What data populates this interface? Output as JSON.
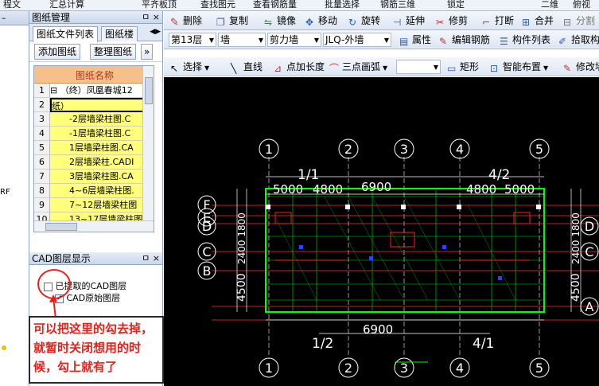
{
  "top_strip": {
    "items": [
      "程文",
      "汇总计算",
      "平齐板顶",
      "查找图元",
      "查看钢筋量",
      "批量选择",
      "钢筋三维",
      "锁定",
      "二维",
      "俯视"
    ]
  },
  "left_narrow": {
    "label": "RF"
  },
  "drawing_manager": {
    "title": "图纸管理",
    "header_btns": "ㅁ ×",
    "tabs": [
      "图纸文件列表",
      "图纸楼"
    ],
    "buttons": [
      "添加图纸",
      "整理图纸"
    ],
    "column_header": "图纸名称",
    "rows": [
      {
        "num": "1",
        "text": "（终）凤凰春城12",
        "style": "tree"
      },
      {
        "num": "2",
        "text": "纸）",
        "style": "selected"
      },
      {
        "num": "3",
        "text": "-2层墙梁柱图.C",
        "style": "yellow"
      },
      {
        "num": "4",
        "text": "-1层墙梁柱图.C",
        "style": "yellow"
      },
      {
        "num": "5",
        "text": "1层墙梁柱图.CA",
        "style": "yellow"
      },
      {
        "num": "6",
        "text": "2层墙梁柱.CADI",
        "style": "yellow"
      },
      {
        "num": "7",
        "text": "3层墙梁柱图.CA",
        "style": "yellow"
      },
      {
        "num": "8",
        "text": "4~6层墙梁柱图.",
        "style": "yellow"
      },
      {
        "num": "9",
        "text": "7~12层墙梁柱图",
        "style": "yellow"
      },
      {
        "num": "10",
        "text": "13~17层墙梁柱图",
        "style": "yellow"
      }
    ]
  },
  "cad_layers": {
    "title": "CAD图层显示",
    "header_btns": "ㅁ ×",
    "items": [
      "已提取的CAD图层",
      "CAD原始图层"
    ]
  },
  "annotation": {
    "text": "可以把这里的勾去掉，就暂时关闭想用的时候，勾上就有了"
  },
  "toolbar1": {
    "items": [
      "删除",
      "复制",
      "镜像",
      "移动",
      "旋转",
      "延伸",
      "修剪",
      "打断",
      "合并",
      "分割"
    ]
  },
  "toolbar2": {
    "floor": "第13层",
    "category": "墙",
    "type": "剪力墙",
    "element": "JLQ-外墙",
    "items": [
      "属性",
      "编辑钢筋",
      "构件列表",
      "拾取构"
    ]
  },
  "toolbar3": {
    "items": [
      "选择",
      "直线",
      "点加长度",
      "三点画弧",
      "矩形",
      "智能布置",
      "修改墙"
    ]
  },
  "drawing": {
    "axis_top": [
      "1",
      "2",
      "3",
      "4",
      "5"
    ],
    "axis_bottom": [
      "1",
      "2",
      "3",
      "4",
      "5"
    ],
    "axis_left": [
      "F",
      "E",
      "D",
      "C",
      "B"
    ],
    "axis_right": [
      "D",
      "C",
      "A"
    ],
    "sub_axes": [
      "1/1",
      "4/2",
      "1/2",
      "4/1"
    ],
    "dims_top": [
      "5000",
      "4800",
      "6900",
      "4800",
      "5000"
    ],
    "dim_bottom": "6900",
    "dim_left": "4500",
    "dim_right": "4500",
    "side_texts_left": "2400 1800",
    "side_texts_right": "2400 1800",
    "colors": {
      "background": "#000000",
      "axis": "#ffffff",
      "wall": "#00ff00",
      "dim": "#ffffff",
      "red": "#ff2020"
    }
  }
}
